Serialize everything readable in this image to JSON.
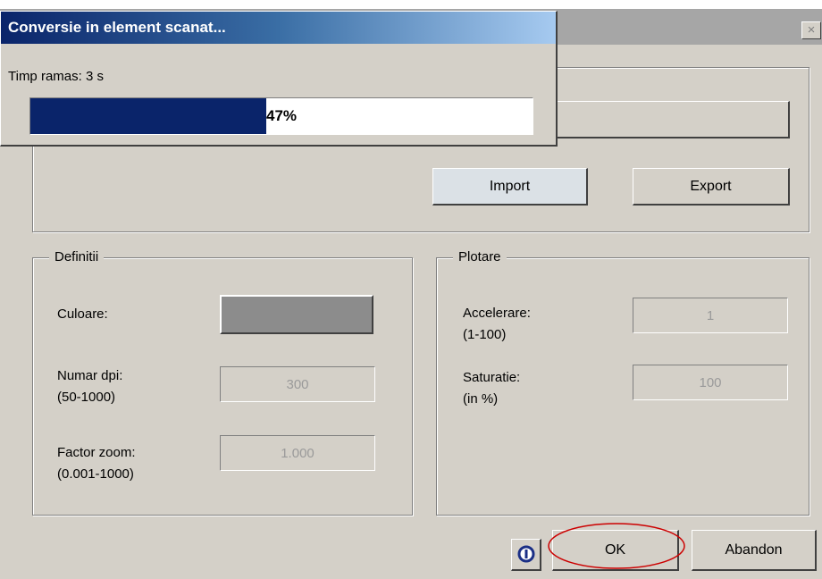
{
  "dialog": {
    "close_glyph": "×",
    "buttons": {
      "import": "Import",
      "export": "Export",
      "ok": "OK",
      "cancel": "Abandon"
    }
  },
  "definitions": {
    "legend": "Definitii",
    "color_label": "Culoare:",
    "dpi_label": "Numar dpi:",
    "dpi_range": "(50-1000)",
    "dpi_value": "300",
    "zoom_label": "Factor zoom:",
    "zoom_range": "(0.001-1000)",
    "zoom_value": "1.000",
    "color_swatch": "#8c8c8c"
  },
  "plotting": {
    "legend": "Plotare",
    "accel_label": "Accelerare:",
    "accel_range": "(1-100)",
    "accel_value": "1",
    "saturation_label": "Saturatie:",
    "saturation_unit": "(in %)",
    "saturation_value": "100"
  },
  "progress_popup": {
    "title": "Conversie in element scanat...",
    "time_remaining": "Timp ramas: 3 s",
    "percent_text": "47%",
    "progress": 0.47
  },
  "annotation": {
    "ellipse_color": "#cc0000"
  },
  "colors": {
    "title_gradient_start": "#0a246a",
    "progress_fill": "#0a246a",
    "dialog_bg": "#d4d0c8"
  },
  "icons": {
    "info": "info-icon",
    "close": "close-icon"
  }
}
